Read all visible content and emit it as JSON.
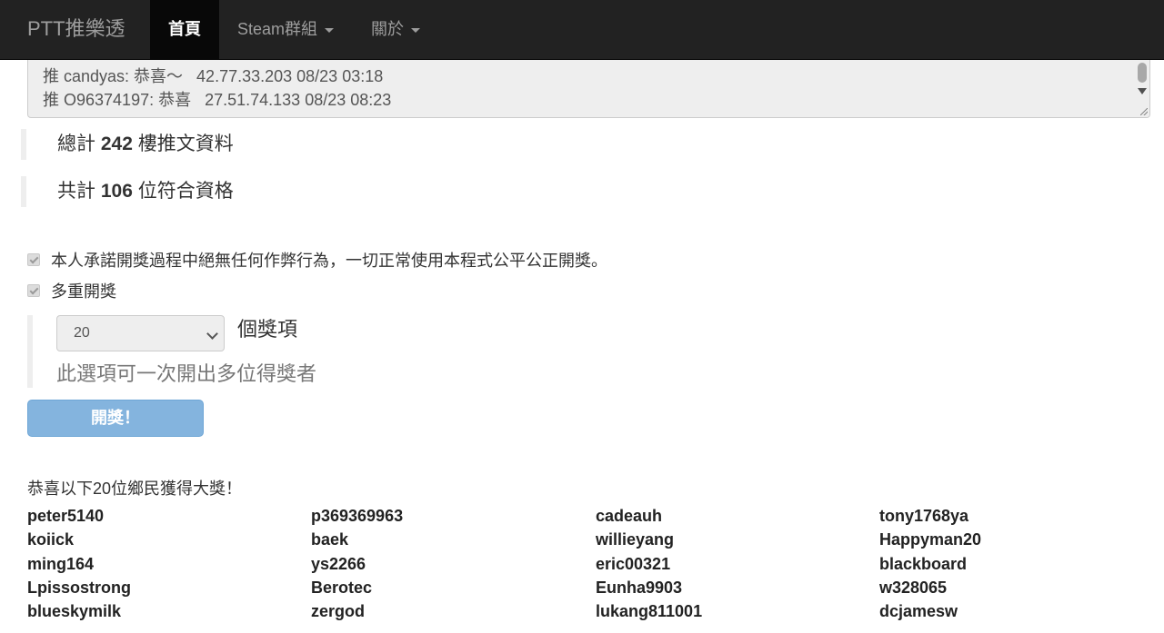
{
  "navbar": {
    "brand": "PTT推樂透",
    "items": [
      {
        "label": "首頁",
        "active": true,
        "dropdown": false
      },
      {
        "label": "Steam群組",
        "active": false,
        "dropdown": true
      },
      {
        "label": "關於",
        "active": false,
        "dropdown": true
      }
    ]
  },
  "push_list": {
    "lines": [
      "推 candyas: 恭喜～   42.77.33.203 08/23 03:18",
      "推 O96374197: 恭喜   27.51.74.133 08/23 08:23"
    ]
  },
  "stats": {
    "total_prefix": "總計",
    "total_count": "242",
    "total_suffix": "樓推文資料",
    "eligible_prefix": "共計",
    "eligible_count": "106",
    "eligible_suffix": "位符合資格"
  },
  "options": {
    "pledge_label": "本人承諾開獎過程中絕無任何作弊行為，一切正常使用本程式公平公正開獎。",
    "pledge_checked": true,
    "multi_label": "多重開獎",
    "multi_checked": true,
    "prize_count": "20",
    "prize_unit": "個獎項",
    "hint": "此選項可一次開出多位得獎者"
  },
  "draw_button": "開獎！",
  "results": {
    "title": "恭喜以下20位鄉民獲得大獎！",
    "winners": [
      [
        "peter5140",
        "p369369963",
        "cadeauh",
        "tony1768ya"
      ],
      [
        "koiick",
        "baek",
        "willieyang",
        "Happyman20"
      ],
      [
        "ming164",
        "ys2266",
        "eric00321",
        "blackboard"
      ],
      [
        "Lpissostrong",
        "Berotec",
        "Eunha9903",
        "w328065"
      ],
      [
        "blueskymilk",
        "zergod",
        "lukang811001",
        "dcjamesw"
      ]
    ]
  },
  "colors": {
    "navbar_bg": "#222222",
    "nav_active_bg": "#080808",
    "button_bg": "#84b4de"
  }
}
